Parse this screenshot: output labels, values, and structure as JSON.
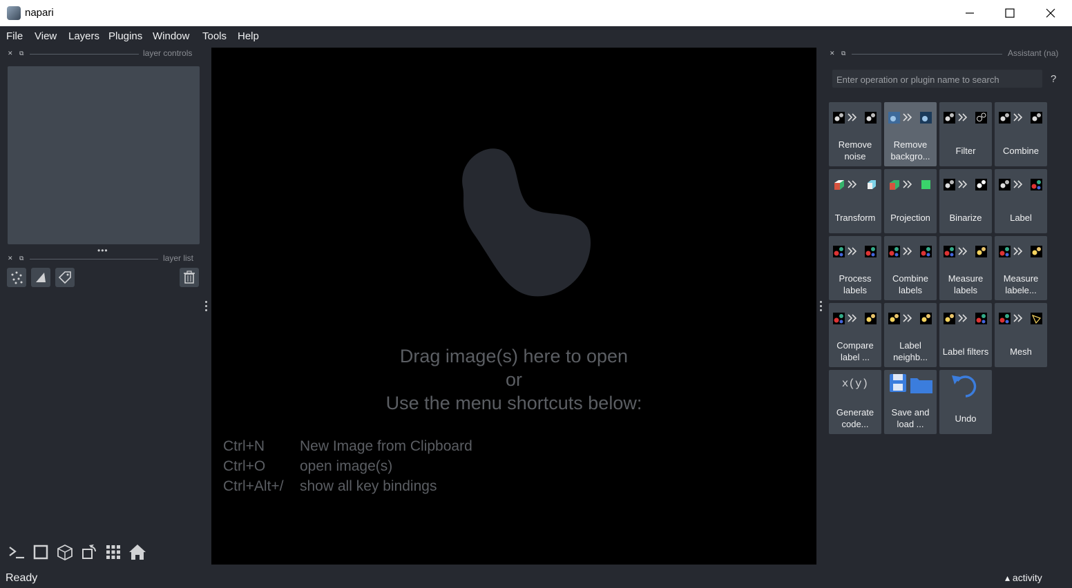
{
  "window": {
    "title": "napari"
  },
  "menu": [
    "File",
    "View",
    "Layers",
    "Plugins",
    "Window",
    "Tools",
    "Help"
  ],
  "left_dock": {
    "layer_controls_label": "layer controls",
    "layer_list_label": "layer list"
  },
  "canvas": {
    "drop_lines": [
      "Drag image(s) here to open",
      "or",
      "Use the menu shortcuts below:"
    ],
    "shortcuts": [
      {
        "key": "Ctrl+N",
        "desc": "New Image from Clipboard"
      },
      {
        "key": "Ctrl+O",
        "desc": "open image(s)"
      },
      {
        "key": "Ctrl+Alt+/",
        "desc": "show all key bindings"
      }
    ]
  },
  "assistant": {
    "title": "Assistant (na)",
    "search_placeholder": "Enter operation or plugin name to search",
    "help": "?",
    "tiles": [
      {
        "line1": "Remove",
        "line2": "noise"
      },
      {
        "line1": "Remove",
        "line2": "backgro..."
      },
      {
        "line1": "Filter",
        "line2": ""
      },
      {
        "line1": "Combine",
        "line2": ""
      },
      {
        "line1": "Transform",
        "line2": ""
      },
      {
        "line1": "Projection",
        "line2": ""
      },
      {
        "line1": "Binarize",
        "line2": ""
      },
      {
        "line1": "Label",
        "line2": ""
      },
      {
        "line1": "Process",
        "line2": "labels"
      },
      {
        "line1": "Combine",
        "line2": "labels"
      },
      {
        "line1": "Measure",
        "line2": "labels"
      },
      {
        "line1": "Measure",
        "line2": "labele..."
      },
      {
        "line1": "Compare",
        "line2": "label ..."
      },
      {
        "line1": "Label",
        "line2": "neighb..."
      },
      {
        "line1": "Label filters",
        "line2": ""
      },
      {
        "line1": "Mesh",
        "line2": ""
      },
      {
        "line1": "Generate",
        "line2": "code..."
      },
      {
        "line1": "Save and",
        "line2": "load ..."
      },
      {
        "line1": "Undo",
        "line2": ""
      }
    ],
    "icon_glyph": "x(y)"
  },
  "status": {
    "text": "Ready",
    "activity": "activity"
  },
  "colors": {
    "bg": "#262930",
    "panel": "#414851",
    "canvas": "#000000",
    "accent": "#3b7ddd"
  }
}
